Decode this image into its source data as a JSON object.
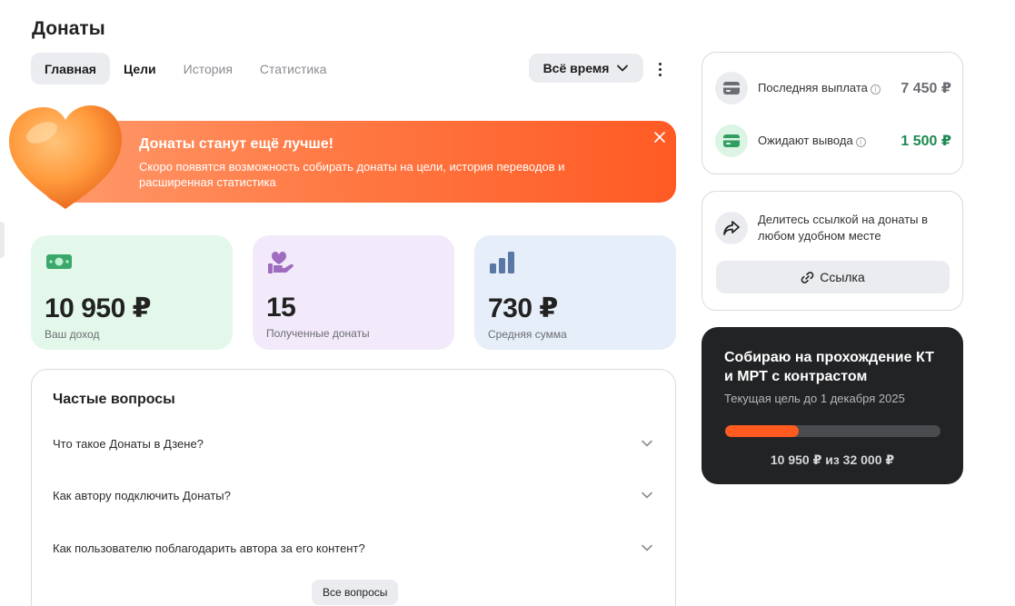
{
  "page": {
    "title": "Донаты"
  },
  "tabs": [
    {
      "label": "Главная"
    },
    {
      "label": "Цели"
    },
    {
      "label": "История"
    },
    {
      "label": "Статистика"
    }
  ],
  "period": {
    "label": "Всё время",
    "icon": "chevron-down-icon"
  },
  "banner": {
    "title": "Донаты станут ещё лучше!",
    "text": "Скоро появятся возможность собирать донаты на цели, история переводов и расширенная статистика",
    "close_icon": "close-icon",
    "gradient": [
      "#ff9a6c",
      "#ff5a24"
    ]
  },
  "stats": [
    {
      "value": "10 950 ₽",
      "label": "Ваш доход",
      "icon": "money-icon",
      "color": "#3aa86b"
    },
    {
      "value": "15",
      "label": "Полученные донаты",
      "icon": "heart-hand-icon",
      "color": "#a06cc0"
    },
    {
      "value": "730 ₽",
      "label": "Средняя сумма",
      "icon": "bar-chart-icon",
      "color": "#5b77a6"
    }
  ],
  "faq": {
    "title": "Частые вопросы",
    "items": [
      {
        "question": "Что такое Донаты в Дзене?"
      },
      {
        "question": "Как автору подключить Донаты?"
      },
      {
        "question": "Как пользователю поблагодарить автора за его контент?"
      }
    ],
    "all_label": "Все вопросы"
  },
  "payouts": {
    "last": {
      "label": "Последняя выплата",
      "amount": "7 450 ₽",
      "icon": "card-icon"
    },
    "pending": {
      "label": "Ожидают вывода",
      "amount": "1 500 ₽",
      "icon": "card-icon",
      "color": "#1d8a52"
    }
  },
  "share": {
    "text": "Делитесь ссылкой на донаты в любом удобном месте",
    "button_label": "Ссылка",
    "icon": "share-icon",
    "button_icon": "link-icon"
  },
  "goal": {
    "title": "Собираю на прохождение КТ и МРТ с контрастом",
    "subtitle": "Текущая цель до 1 декабря 2025",
    "progress": 0.342,
    "amount_text": "10 950 ₽ из 32 000 ₽",
    "accent": "#ff5a1f"
  }
}
